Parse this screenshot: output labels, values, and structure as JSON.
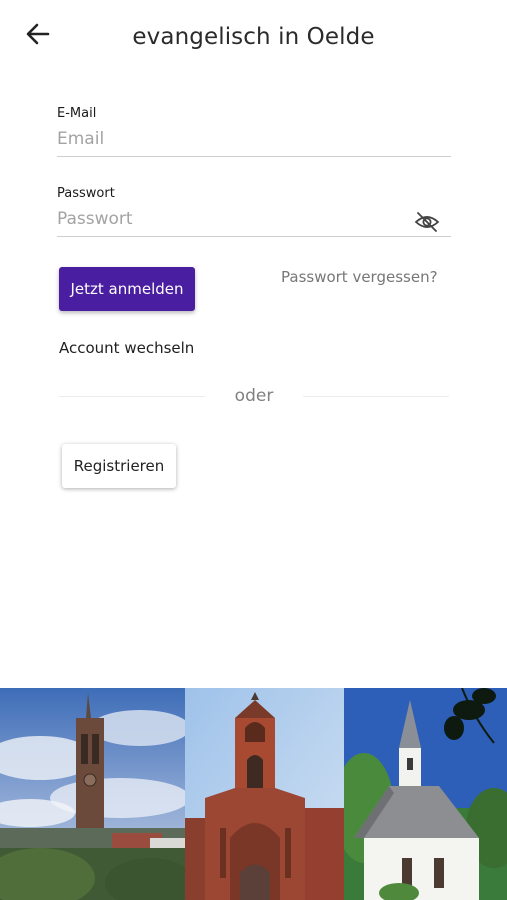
{
  "header": {
    "title": "evangelisch in Oelde",
    "back_icon": "arrow-left-icon"
  },
  "form": {
    "email": {
      "label": "E-Mail",
      "placeholder": "Email",
      "value": ""
    },
    "password": {
      "label": "Passwort",
      "placeholder": "Passwort",
      "value": "",
      "visibility_icon": "eye-off-icon"
    },
    "login_label": "Jetzt anmelden",
    "forgot_label": "Passwort vergessen?",
    "switch_account_label": "Account wechseln",
    "divider_label": "oder",
    "register_label": "Registrieren"
  },
  "colors": {
    "primary": "#4a1ea0",
    "text": "#222222",
    "muted": "#777777"
  },
  "banner": {
    "photos": [
      "church-tower-photo",
      "brick-church-photo",
      "white-chapel-photo"
    ]
  }
}
